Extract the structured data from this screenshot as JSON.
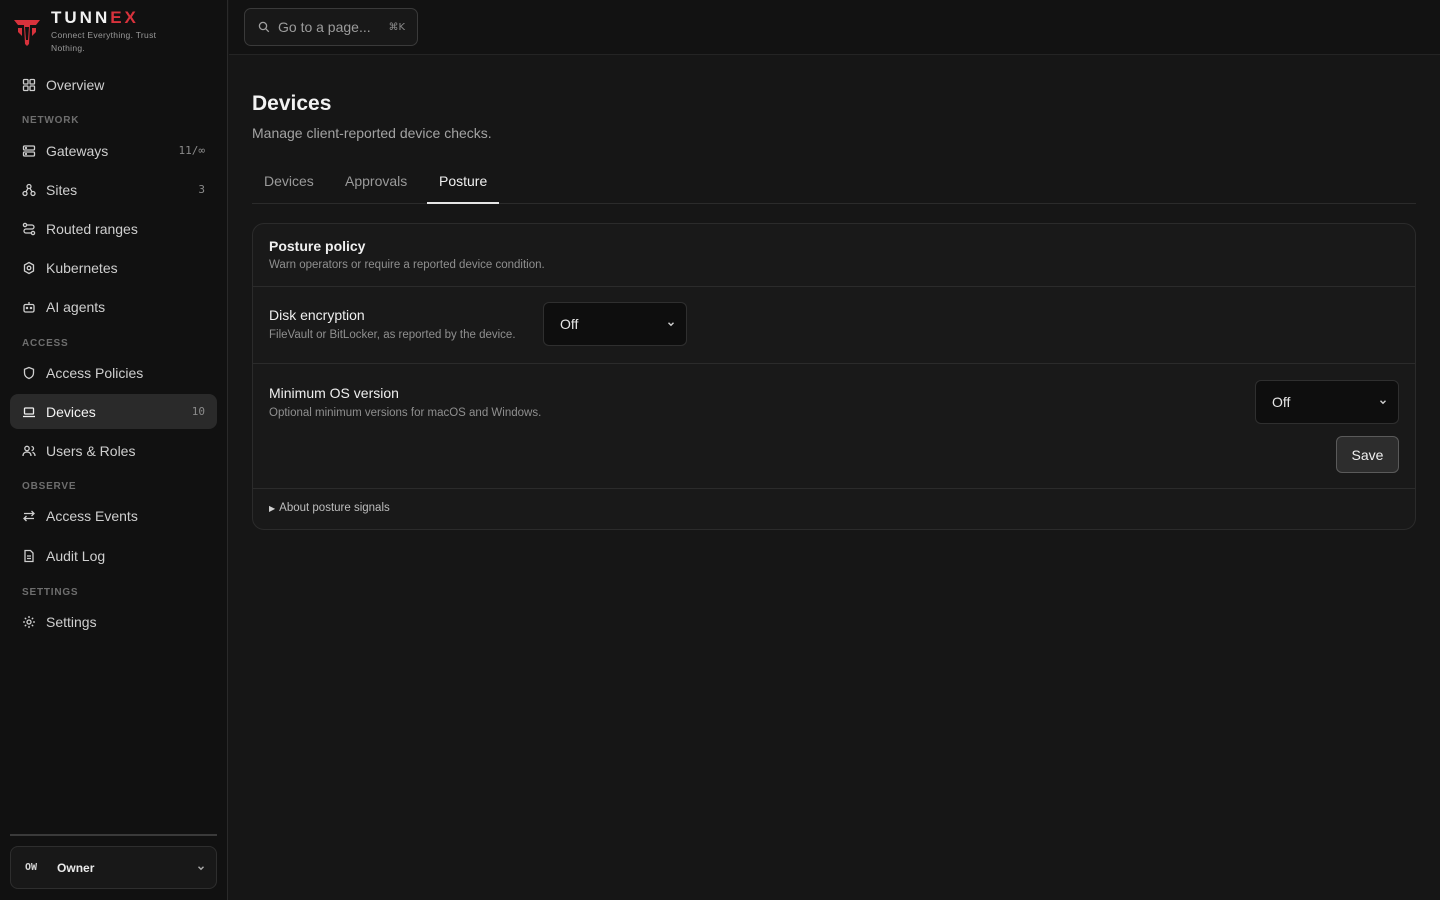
{
  "brand": {
    "name_main": "TUNN",
    "name_accent": "EX",
    "tagline": "Connect Everything. Trust Nothing.",
    "accent_color": "#d8323c"
  },
  "sidebar": {
    "overview": {
      "label": "Overview",
      "icon": "grid-icon"
    },
    "sections": {
      "network": "NETWORK",
      "access": "ACCESS",
      "observe": "OBSERVE",
      "settings": "SETTINGS"
    },
    "items": {
      "gateways": {
        "label": "Gateways",
        "count": "11/∞",
        "icon": "server-icon"
      },
      "sites": {
        "label": "Sites",
        "count": "3",
        "icon": "sites-icon"
      },
      "routed_ranges": {
        "label": "Routed ranges",
        "icon": "route-icon"
      },
      "kubernetes": {
        "label": "Kubernetes",
        "icon": "kubernetes-icon"
      },
      "ai_agents": {
        "label": "AI agents",
        "icon": "bot-icon"
      },
      "access_policies": {
        "label": "Access Policies",
        "icon": "shield-icon"
      },
      "devices": {
        "label": "Devices",
        "count": "10",
        "icon": "laptop-icon",
        "active": true
      },
      "users_roles": {
        "label": "Users & Roles",
        "icon": "users-icon"
      },
      "access_events": {
        "label": "Access Events",
        "icon": "arrows-icon"
      },
      "audit_log": {
        "label": "Audit Log",
        "icon": "document-icon"
      },
      "settings": {
        "label": "Settings",
        "icon": "gear-icon"
      }
    },
    "account": {
      "initials": "OW",
      "name": "Owner"
    }
  },
  "topbar": {
    "search_placeholder": "Go to a page...",
    "search_shortcut": "⌘K"
  },
  "page": {
    "title": "Devices",
    "subtitle": "Manage client-reported device checks.",
    "tabs": [
      {
        "label": "Devices",
        "active": false
      },
      {
        "label": "Approvals",
        "active": false
      },
      {
        "label": "Posture",
        "active": true
      }
    ]
  },
  "posture": {
    "title": "Posture policy",
    "description": "Warn operators or require a reported device condition.",
    "disk_encryption": {
      "title": "Disk encryption",
      "description": "FileVault or BitLocker, as reported by the device.",
      "value": "Off"
    },
    "min_os": {
      "title": "Minimum OS version",
      "description": "Optional minimum versions for macOS and Windows.",
      "value": "Off"
    },
    "save_label": "Save",
    "about_label": "About posture signals"
  }
}
